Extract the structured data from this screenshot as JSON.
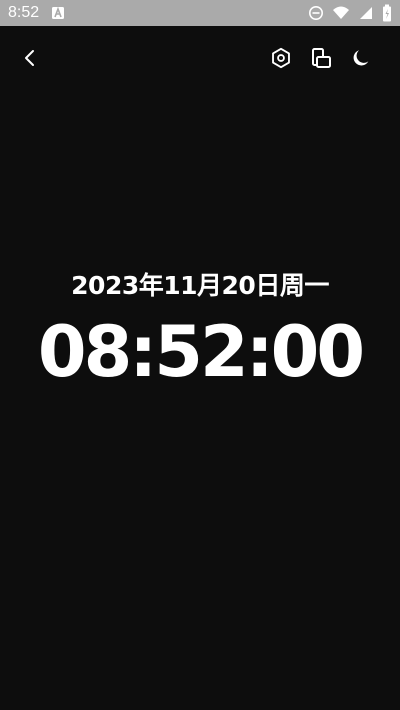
{
  "status_bar": {
    "time": "8:52",
    "left_icons": [
      "keyboard-a-icon"
    ],
    "right_icons": [
      "do-not-disturb-icon",
      "wifi-icon",
      "cellular-signal-icon",
      "battery-icon"
    ],
    "background": "#aaaaaa"
  },
  "toolbar": {
    "back_icon": "chevron-left-icon",
    "settings_icon": "gear-icon",
    "rotate_icon": "screen-rotate-icon",
    "night_icon": "moon-icon"
  },
  "clock": {
    "date": "2023年11月20日周一",
    "time": "08:52:00"
  },
  "colors": {
    "background": "#0d0d0d",
    "text": "#ffffff"
  }
}
